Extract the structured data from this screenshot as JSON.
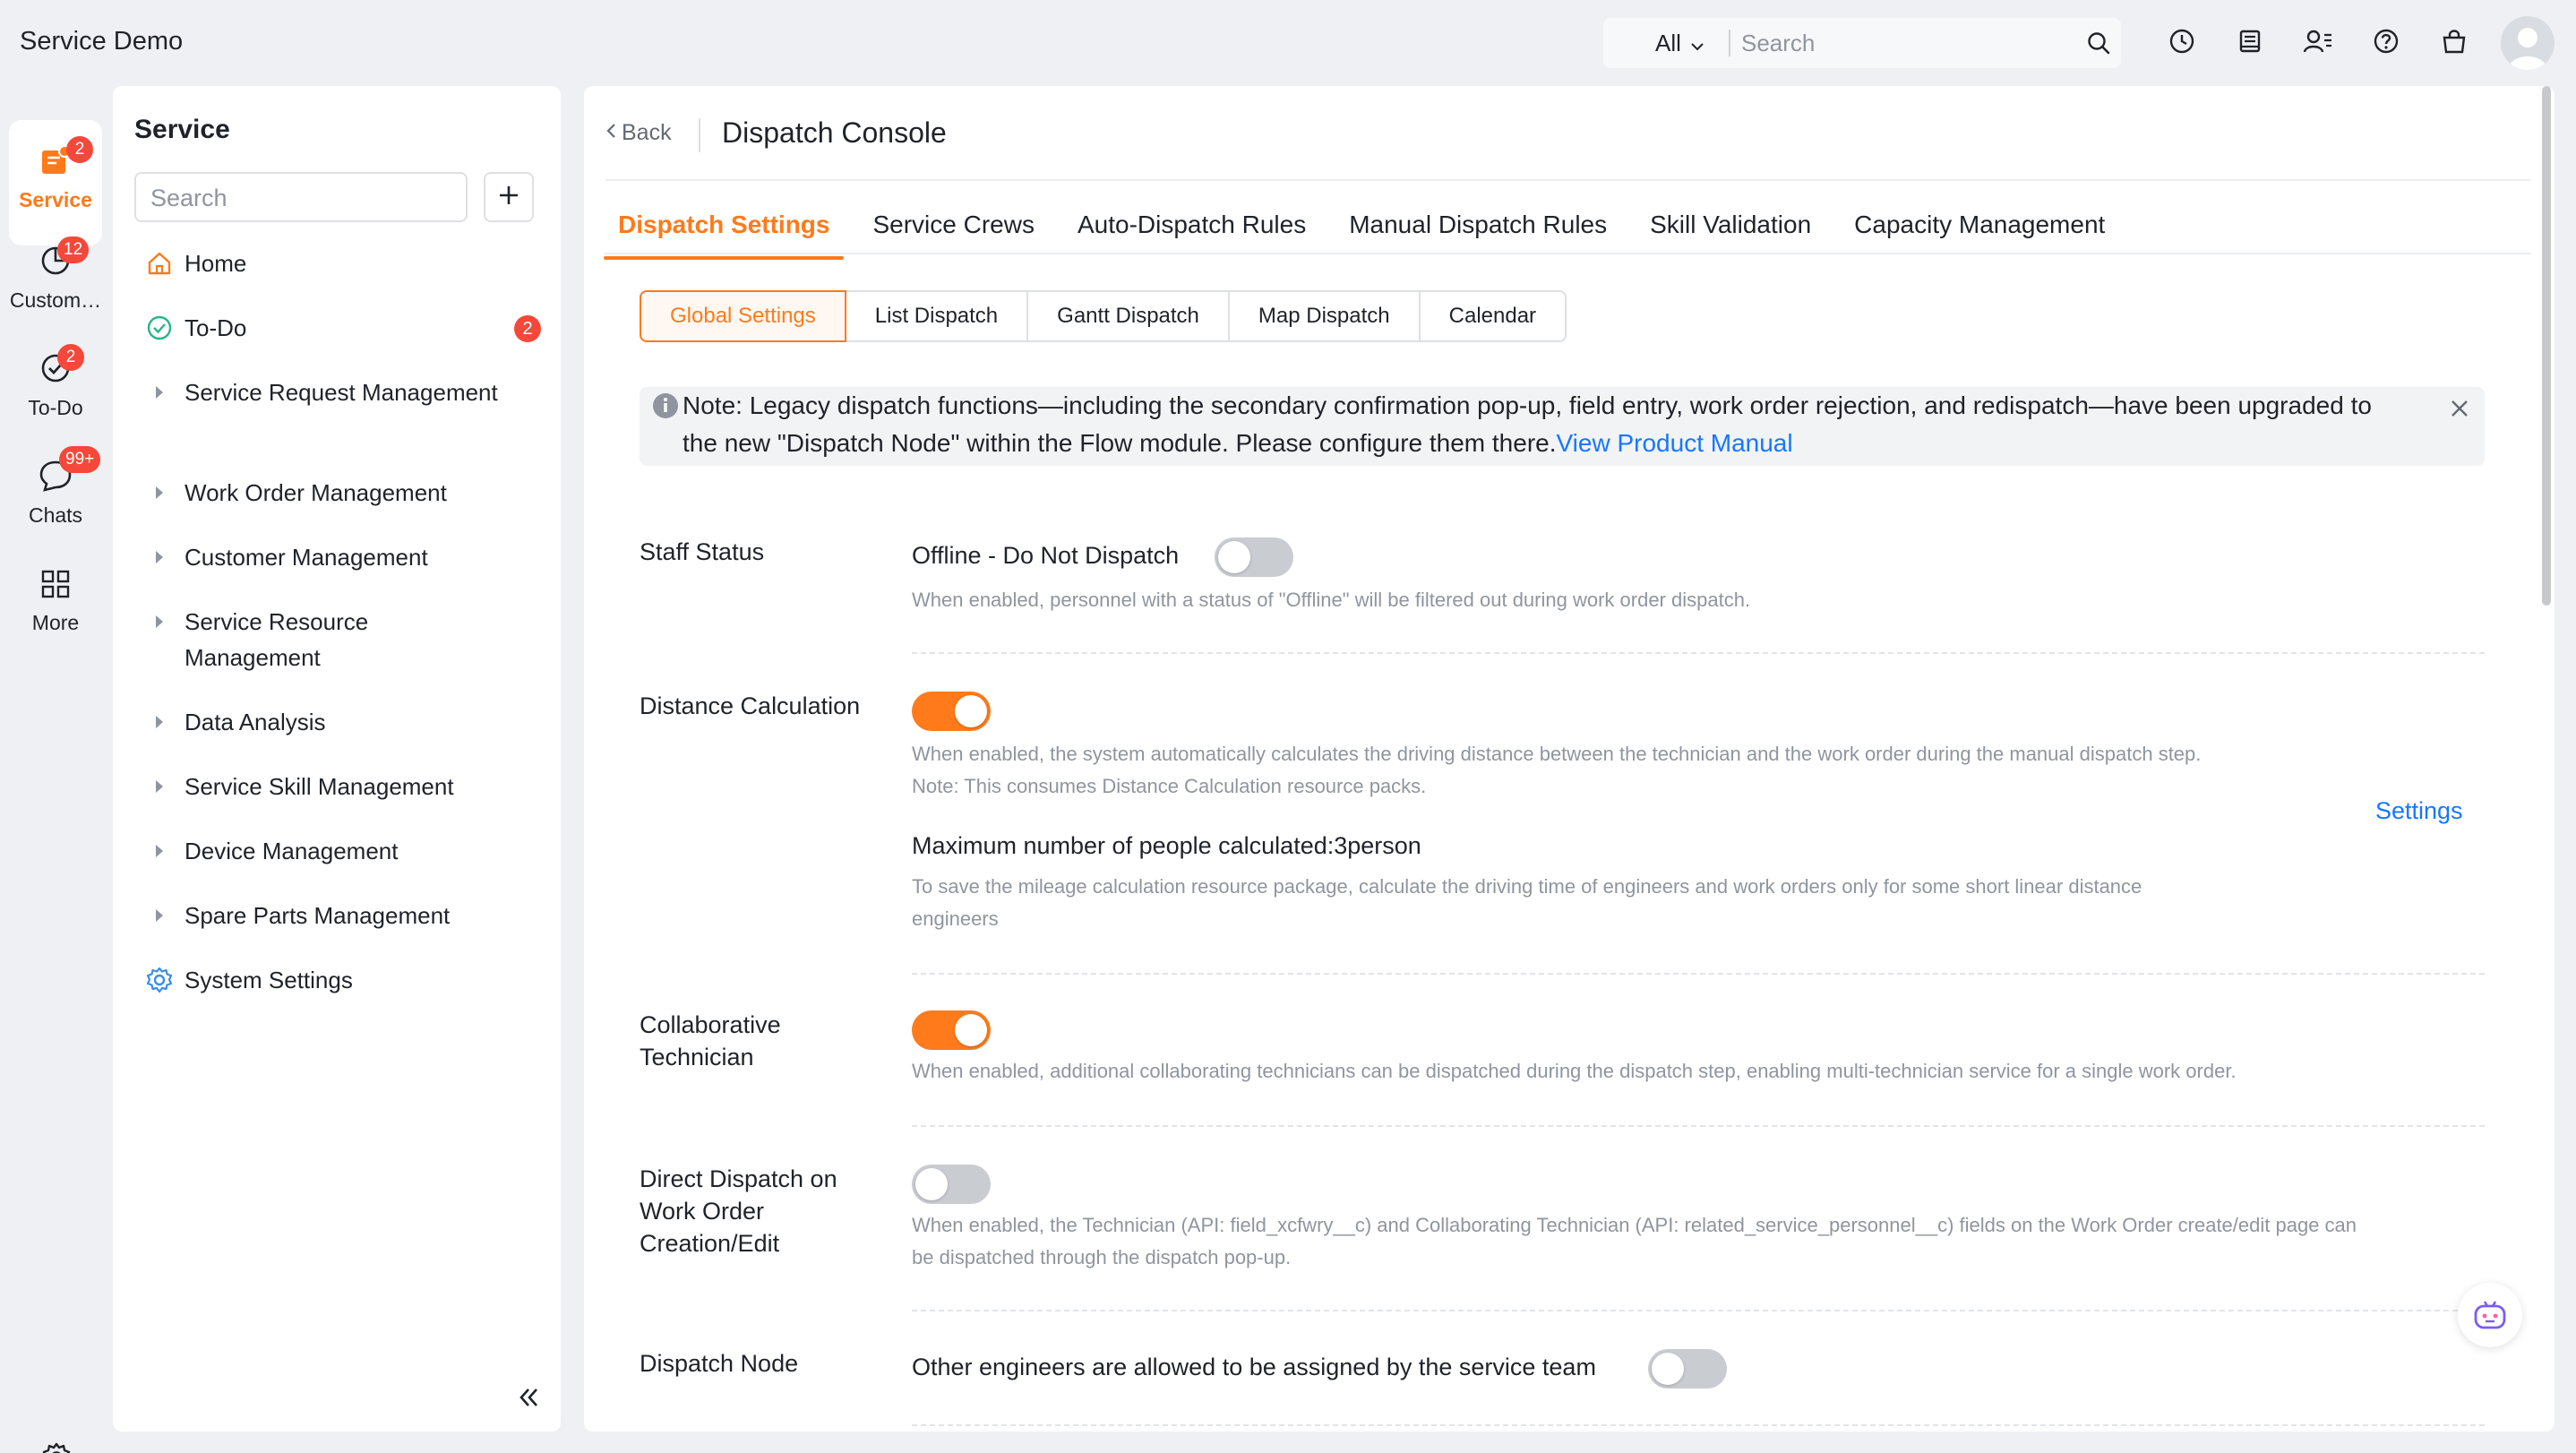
{
  "app": {
    "title": "Service Demo"
  },
  "topbar": {
    "scope": "All",
    "search_placeholder": "Search",
    "icons": [
      "clock-icon",
      "notes-icon",
      "contacts-icon",
      "help-icon",
      "bag-icon"
    ]
  },
  "rail": {
    "items": [
      {
        "label": "Service",
        "badge": "2",
        "icon": "service-icon"
      },
      {
        "label": "Custom…",
        "badge": "12",
        "icon": "customer-icon"
      },
      {
        "label": "To-Do",
        "badge": "2",
        "icon": "todo-icon"
      },
      {
        "label": "Chats",
        "badge": "99+",
        "icon": "chat-icon"
      },
      {
        "label": "More",
        "badge": "",
        "icon": "grid-icon"
      }
    ]
  },
  "sidebar": {
    "title": "Service",
    "search_placeholder": "Search",
    "items": [
      {
        "label": "Home",
        "icon": "home-icon"
      },
      {
        "label": "To-Do",
        "icon": "check-circle-icon",
        "badge": "2"
      },
      {
        "label": "Service Request Management",
        "icon": "caret-right-icon"
      },
      {
        "label": "Work Order Management",
        "icon": "caret-right-icon"
      },
      {
        "label": "Customer Management",
        "icon": "caret-right-icon"
      },
      {
        "label": "Service Resource Management",
        "icon": "caret-right-icon"
      },
      {
        "label": "Data Analysis",
        "icon": "caret-right-icon"
      },
      {
        "label": "Service Skill Management",
        "icon": "caret-right-icon"
      },
      {
        "label": "Device Management",
        "icon": "caret-right-icon"
      },
      {
        "label": "Spare Parts Management",
        "icon": "caret-right-icon"
      },
      {
        "label": "System Settings",
        "icon": "gear-icon"
      }
    ]
  },
  "main": {
    "back_label": "Back",
    "title": "Dispatch Console",
    "tabs": [
      {
        "label": "Dispatch Settings",
        "active": true
      },
      {
        "label": "Service Crews"
      },
      {
        "label": "Auto-Dispatch Rules"
      },
      {
        "label": "Manual Dispatch Rules"
      },
      {
        "label": "Skill Validation"
      },
      {
        "label": "Capacity Management"
      }
    ],
    "subtabs": [
      {
        "label": "Global Settings",
        "active": true
      },
      {
        "label": "List Dispatch"
      },
      {
        "label": "Gantt Dispatch"
      },
      {
        "label": "Map Dispatch"
      },
      {
        "label": "Calendar"
      }
    ],
    "notice": {
      "text": "Note: Legacy dispatch functions—including the secondary confirmation pop-up, field entry, work order rejection, and redispatch—have been upgraded to the new \"Dispatch Node\" within the Flow module. Please configure them there.",
      "link": "View Product Manual"
    },
    "settings": {
      "staff_status": {
        "label": "Staff Status",
        "option": "Offline - Do Not Dispatch",
        "enabled": false,
        "desc": "When enabled, personnel with a status of \"Offline\" will be filtered out during work order dispatch."
      },
      "distance": {
        "label": "Distance Calculation",
        "enabled": true,
        "desc1": "When enabled, the system automatically calculates the driving distance between the technician and the work order during the manual dispatch step.",
        "desc2": "Note: This consumes Distance Calculation resource packs.",
        "settings_link": "Settings",
        "max_people": "Maximum number of people calculated:3person",
        "max_desc1": "To save the mileage calculation resource package, calculate the driving time of engineers and work orders only for some short linear distance",
        "max_desc2": "engineers"
      },
      "collab": {
        "label_line1": "Collaborative",
        "label_line2": "Technician",
        "enabled": true,
        "desc": "When enabled, additional collaborating technicians can be dispatched during the dispatch step, enabling multi-technician service for a single work order."
      },
      "direct": {
        "label_line1": "Direct Dispatch on",
        "label_line2": "Work Order",
        "label_line3": "Creation/Edit",
        "enabled": false,
        "desc1": "When enabled, the Technician (API: field_xcfwry__c) and Collaborating Technician (API: related_service_personnel__c) fields on the Work Order create/edit page can",
        "desc2": "be dispatched through the dispatch pop-up."
      },
      "node": {
        "label": "Dispatch Node",
        "option": "Other engineers are allowed to be assigned by the service team",
        "enabled": false
      }
    }
  },
  "colors": {
    "accent": "#ff7a1a",
    "link": "#1677ff",
    "badge": "#f5483b"
  }
}
